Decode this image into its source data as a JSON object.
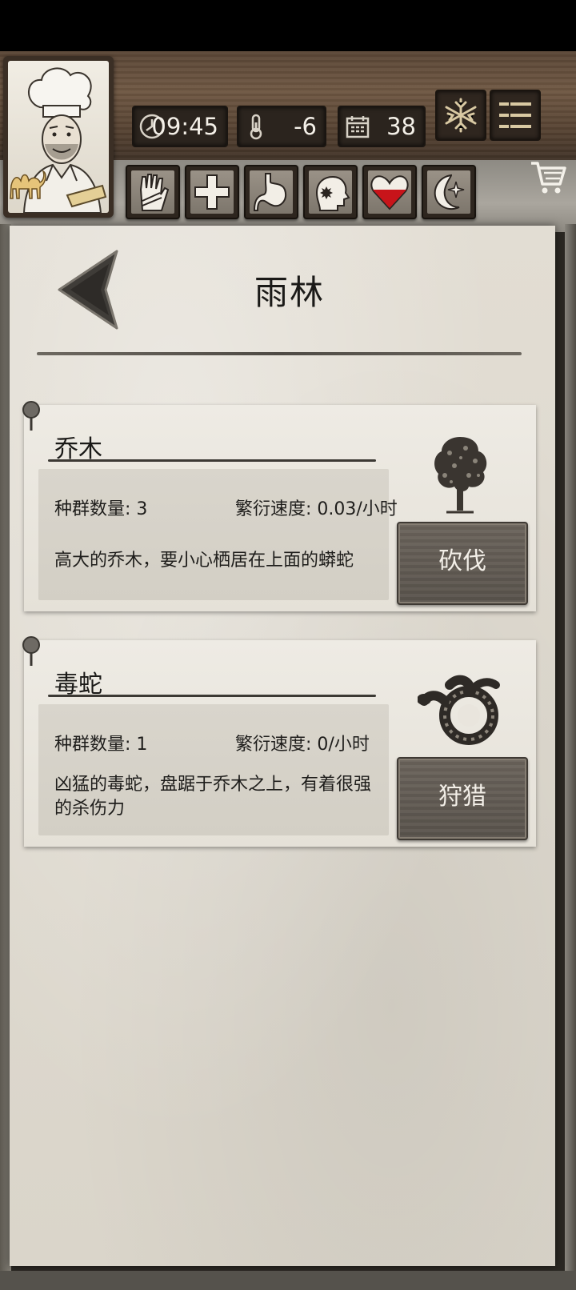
{
  "stats": {
    "time": "09:45",
    "temperature": "-6",
    "day": "38"
  },
  "page": {
    "title": "雨林"
  },
  "species": [
    {
      "name": "乔木",
      "population_label": "种群数量: 3",
      "growth_label": "繁衍速度: 0.03/小时",
      "description": "高大的乔木，要小心栖居在上面的蟒蛇",
      "action": "砍伐",
      "icon": "tree-icon"
    },
    {
      "name": "毒蛇",
      "population_label": "种群数量: 1",
      "growth_label": "繁衍速度: 0/小时",
      "description": "凶猛的毒蛇，盘踞于乔木之上，有着很强的杀伤力",
      "action": "狩猎",
      "icon": "snake-icon"
    }
  ],
  "status_icons": [
    "hand-icon",
    "health-cross-icon",
    "stomach-icon",
    "mind-icon",
    "heart-icon",
    "sleep-moon-icon"
  ],
  "colors": {
    "paper": "#e2ddd3",
    "card": "#eeebe4",
    "button": "#5f5851",
    "heart_fill": "#c8141a",
    "wood": "#5a4636"
  }
}
